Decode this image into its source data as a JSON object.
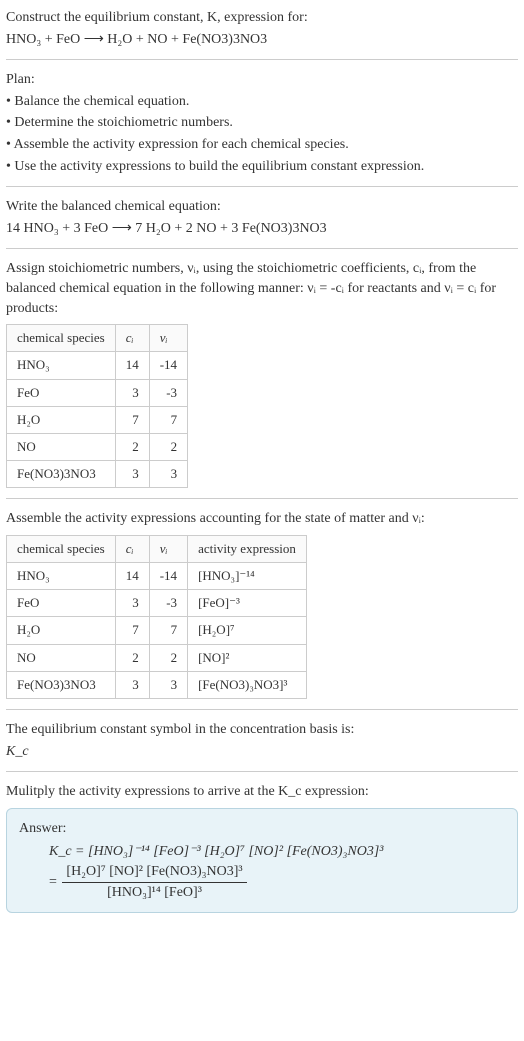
{
  "intro": {
    "line1": "Construct the equilibrium constant, K, expression for:",
    "line2": "HNO₃ + FeO ⟶ H₂O + NO + Fe(NO3)3NO3"
  },
  "plan": {
    "title": "Plan:",
    "b1": "• Balance the chemical equation.",
    "b2": "• Determine the stoichiometric numbers.",
    "b3": "• Assemble the activity expression for each chemical species.",
    "b4": "• Use the activity expressions to build the equilibrium constant expression."
  },
  "balanced": {
    "l1": "Write the balanced chemical equation:",
    "l2": "14 HNO₃ + 3 FeO ⟶ 7 H₂O + 2 NO + 3 Fe(NO3)3NO3"
  },
  "assign": {
    "l1": "Assign stoichiometric numbers, νᵢ, using the stoichiometric coefficients, cᵢ, from the balanced chemical equation in the following manner: νᵢ = -cᵢ for reactants and νᵢ = cᵢ for products:"
  },
  "table1": {
    "h1": "chemical species",
    "h2": "cᵢ",
    "h3": "νᵢ",
    "rows": [
      {
        "s": "HNO₃",
        "c": "14",
        "v": "-14"
      },
      {
        "s": "FeO",
        "c": "3",
        "v": "-3"
      },
      {
        "s": "H₂O",
        "c": "7",
        "v": "7"
      },
      {
        "s": "NO",
        "c": "2",
        "v": "2"
      },
      {
        "s": "Fe(NO3)3NO3",
        "c": "3",
        "v": "3"
      }
    ]
  },
  "assemble": {
    "l1": "Assemble the activity expressions accounting for the state of matter and νᵢ:"
  },
  "table2": {
    "h1": "chemical species",
    "h2": "cᵢ",
    "h3": "νᵢ",
    "h4": "activity expression",
    "rows": [
      {
        "s": "HNO₃",
        "c": "14",
        "v": "-14",
        "a": "[HNO₃]⁻¹⁴"
      },
      {
        "s": "FeO",
        "c": "3",
        "v": "-3",
        "a": "[FeO]⁻³"
      },
      {
        "s": "H₂O",
        "c": "7",
        "v": "7",
        "a": "[H₂O]⁷"
      },
      {
        "s": "NO",
        "c": "2",
        "v": "2",
        "a": "[NO]²"
      },
      {
        "s": "Fe(NO3)3NO3",
        "c": "3",
        "v": "3",
        "a": "[Fe(NO3)₃NO3]³"
      }
    ]
  },
  "eqsym": {
    "l1": "The equilibrium constant symbol in the concentration basis is:",
    "l2": "K_c"
  },
  "mult": {
    "l1": "Mulitply the activity expressions to arrive at the K_c expression:"
  },
  "answer": {
    "label": "Answer:",
    "line1": "K_c = [HNO₃]⁻¹⁴ [FeO]⁻³ [H₂O]⁷ [NO]² [Fe(NO3)₃NO3]³",
    "frac_num": "[H₂O]⁷ [NO]² [Fe(NO3)₃NO3]³",
    "frac_den": "[HNO₃]¹⁴ [FeO]³",
    "eq": " = "
  },
  "chart_data": {
    "type": "table",
    "tables": [
      {
        "title": "stoichiometric numbers",
        "columns": [
          "chemical species",
          "cᵢ",
          "νᵢ"
        ],
        "rows": [
          [
            "HNO₃",
            14,
            -14
          ],
          [
            "FeO",
            3,
            -3
          ],
          [
            "H₂O",
            7,
            7
          ],
          [
            "NO",
            2,
            2
          ],
          [
            "Fe(NO3)3NO3",
            3,
            3
          ]
        ]
      },
      {
        "title": "activity expressions",
        "columns": [
          "chemical species",
          "cᵢ",
          "νᵢ",
          "activity expression"
        ],
        "rows": [
          [
            "HNO₃",
            14,
            -14,
            "[HNO₃]^-14"
          ],
          [
            "FeO",
            3,
            -3,
            "[FeO]^-3"
          ],
          [
            "H₂O",
            7,
            7,
            "[H₂O]^7"
          ],
          [
            "NO",
            2,
            2,
            "[NO]^2"
          ],
          [
            "Fe(NO3)3NO3",
            3,
            3,
            "[Fe(NO3)3NO3]^3"
          ]
        ]
      }
    ]
  }
}
